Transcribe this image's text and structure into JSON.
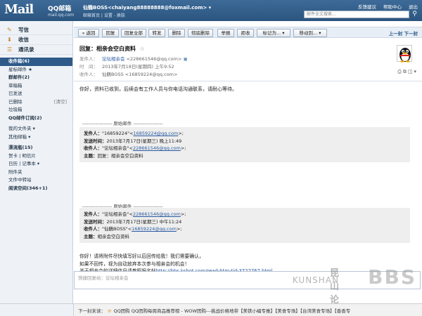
{
  "header": {
    "logo": "Mail",
    "logo_sub": "QQ邮箱",
    "logo_domain": "mail.qq.com",
    "user": "仙鶴BOSS<chaiyang88888888@foxmail.com>",
    "user_caret": "▾",
    "user_links": "邮箱首页 | 设置 - 换肤",
    "top_links": [
      "反馈建议",
      "帮助中心",
      "退出"
    ],
    "search_placeholder": "邮件全文搜索..."
  },
  "sidebar": {
    "buttons": [
      {
        "label": "写信",
        "icon": "✎"
      },
      {
        "label": "收信",
        "icon": "⬇"
      },
      {
        "label": "通讯录",
        "icon": "☰"
      }
    ],
    "folders": [
      {
        "label": "收件箱(6)",
        "bold": true,
        "active": true
      },
      {
        "label": "星标邮件 ★",
        "bold": false
      },
      {
        "label": "群邮件(2)",
        "bold": true
      },
      {
        "label": "草稿箱",
        "bold": false
      },
      {
        "label": "已发送",
        "bold": false
      },
      {
        "label": "已删除",
        "bold": false,
        "right": "[清空]"
      },
      {
        "label": "垃圾箱",
        "bold": false
      },
      {
        "label": "QQ邮件订阅(2)",
        "bold": true
      }
    ],
    "folders2": [
      {
        "label": "我的文件夹 ▾",
        "bold": false
      },
      {
        "label": "其他邮箱 ▾",
        "bold": false
      }
    ],
    "apps": [
      {
        "label": "漂流瓶(15)",
        "bold": true
      },
      {
        "label": "贺卡 | 明信片",
        "bold": false
      },
      {
        "label": "日历 | 记事本 ▾",
        "bold": false
      },
      {
        "label": "附件夹",
        "bold": false
      },
      {
        "label": "文件中转站",
        "bold": false
      },
      {
        "label": "阅读空间(346+1)",
        "bold": true
      }
    ]
  },
  "toolbar": {
    "buttons": [
      "« 返回",
      "回复",
      "回复全部",
      "转发",
      "删除",
      "彻底删除",
      "举报",
      "拒收",
      "标记为... ▾",
      "移动到... ▾"
    ],
    "pager": "上一封  下一封"
  },
  "message": {
    "subject": "回复：相亲会空白资料",
    "star": "☆",
    "from_label": "发件人：",
    "from_name": "论坛相亲会",
    "from_addr": "<228661546@qq.com>",
    "time_label": "时　间：",
    "time_value": "2013年7月18日(星期四) 上午9:52",
    "to_label": "收件人：",
    "to_value": "仙鶴BOSS <16859224@qq.com>",
    "body_line1": "你好，资料已收到，后续会有工作人员与你电话沟通联系，请耐心等待。",
    "original_divider": "------------------ 原始邮件 ------------------",
    "quote1": {
      "from_label": "发件人：",
      "from_value": "\"16859224\"<",
      "from_link": "16859224@qq.com",
      "from_end": ">;",
      "time_label": "发送时间：",
      "time_value": "2013年7月17日(星期三) 晚上11:49",
      "to_label": "收件人：",
      "to_value": "\"论坛相亲会\"<",
      "to_link": "228661546@qq.com",
      "to_end": ">;",
      "subject_label": "主题：",
      "subject_value": "回复：相亲会空白资料"
    },
    "quote2": {
      "from_label": "发件人：",
      "from_value": "\"论坛相亲会\"<",
      "from_link": "228661546@qq.com",
      "from_end": ">;",
      "time_label": "发送时间：",
      "time_value": "2013年7月17日(星期三) 中午11:24",
      "to_label": "收件人：",
      "to_value": "\"仙鶴BOSS\"<",
      "to_link": "16859224@qq.com",
      "to_end": ">;",
      "subject_label": "主题：",
      "subject_value": "相亲会空白资料"
    },
    "closing1": "你好！请将附件尽快填写好以后回传给我！我们需要确认，",
    "closing2": "如果不回传，视为自动放弃本次参与相亲会的机会！",
    "closing3_pre": "关于相亲会的详细信息请参照报名帖",
    "closing3_link": "http://bbs.kshot.com/read-htm-tid-3722767.html"
  },
  "reply": {
    "placeholder": "快捷回复给：论坛相亲会"
  },
  "watermark": {
    "cn": "昆山论坛",
    "en": "KUNSHAN",
    "bbs": "BBS"
  },
  "bottom": {
    "prefix": "下一封未读：",
    "text": "QQ团购   QQ团购每周商品推荐榜 - WOW团购---挑战价格地带【美铁小编专推】【美食专场】【台湾美食专场】【香香专"
  }
}
